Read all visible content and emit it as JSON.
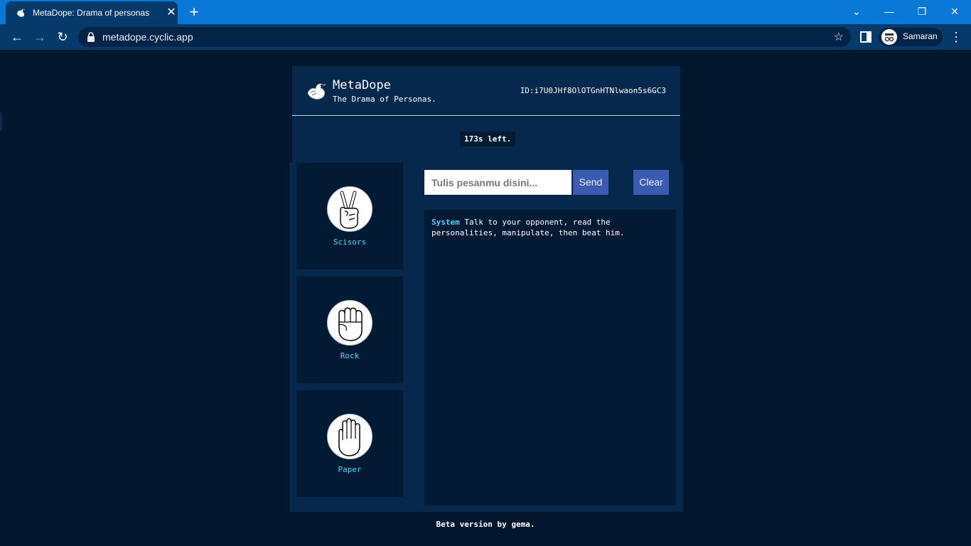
{
  "browser": {
    "tab_title": "MetaDope: Drama of personas",
    "tab_close": "✕",
    "new_tab": "+",
    "url": "metadope.cyclic.app",
    "profile_name": "Samaran",
    "win_controls": {
      "tab_search": "⌄",
      "minimize": "—",
      "restore": "❐",
      "close": "✕"
    },
    "nav": {
      "back": "←",
      "forward": "→",
      "reload": "↻",
      "bookmark": "☆",
      "menu": "⋮"
    }
  },
  "header": {
    "title": "MetaDope",
    "subtitle": "The Drama of Personas.",
    "id": "ID:i7U0JHf8OlOTGnHTNlwaon5s6GC3"
  },
  "timer": {
    "text": "173s left."
  },
  "choices": [
    {
      "label": "Scisors",
      "icon": "scissors-hand-icon"
    },
    {
      "label": "Rock",
      "icon": "rock-fist-icon"
    },
    {
      "label": "Paper",
      "icon": "paper-hand-icon"
    }
  ],
  "chat": {
    "placeholder": "Tulis pesanmu disini...",
    "send_label": "Send",
    "clear_label": "Clear",
    "messages": [
      {
        "sender": "System",
        "text": "Talk to your opponent, read the personalities, manipulate, then beat him."
      }
    ]
  },
  "footer": {
    "text": "Beta version by gema."
  },
  "colors": {
    "page_bg": "#02162e",
    "panel_bg": "#06284c",
    "dark_cell": "#021a33",
    "accent_cyan": "#4fd6f4",
    "button_blue": "#3b5bb0",
    "chrome_blue": "#0a78d7"
  }
}
